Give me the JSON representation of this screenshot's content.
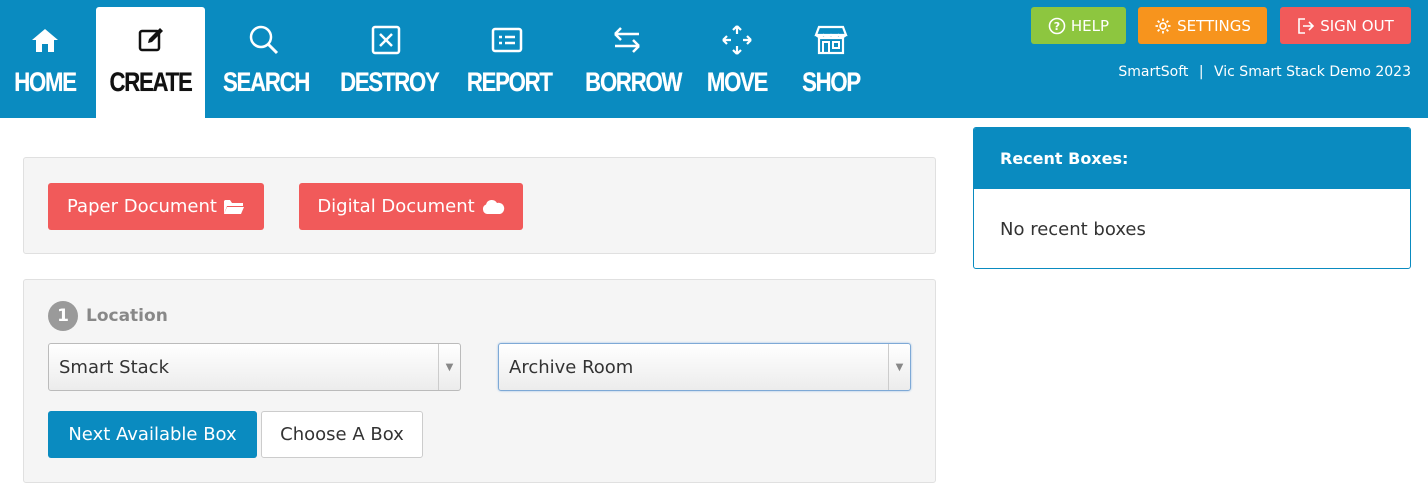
{
  "nav": {
    "items": [
      {
        "label": "HOME",
        "icon": "home-icon"
      },
      {
        "label": "CREATE",
        "icon": "edit-icon",
        "active": true
      },
      {
        "label": "SEARCH",
        "icon": "search-icon"
      },
      {
        "label": "DESTROY",
        "icon": "destroy-icon"
      },
      {
        "label": "REPORT",
        "icon": "report-icon"
      },
      {
        "label": "BORROW",
        "icon": "borrow-icon"
      },
      {
        "label": "MOVE",
        "icon": "move-icon"
      },
      {
        "label": "SHOP",
        "icon": "shop-icon"
      }
    ]
  },
  "top_buttons": {
    "help": "HELP",
    "settings": "SETTINGS",
    "sign_out": "SIGN OUT"
  },
  "brand": {
    "company": "SmartSoft",
    "separator": "|",
    "product": "Vic Smart Stack Demo 2023"
  },
  "documents": {
    "paper_label": "Paper Document",
    "digital_label": "Digital Document"
  },
  "location": {
    "step_number": "1",
    "title": "Location",
    "stack_value": "Smart Stack",
    "room_value": "Archive Room",
    "next_box_label": "Next Available Box",
    "choose_box_label": "Choose A Box"
  },
  "recent": {
    "title": "Recent Boxes:",
    "empty_text": "No recent boxes"
  },
  "colors": {
    "primary": "#0a8bc0",
    "help": "#8dc63f",
    "settings": "#f7941d",
    "danger": "#f15a5a"
  }
}
